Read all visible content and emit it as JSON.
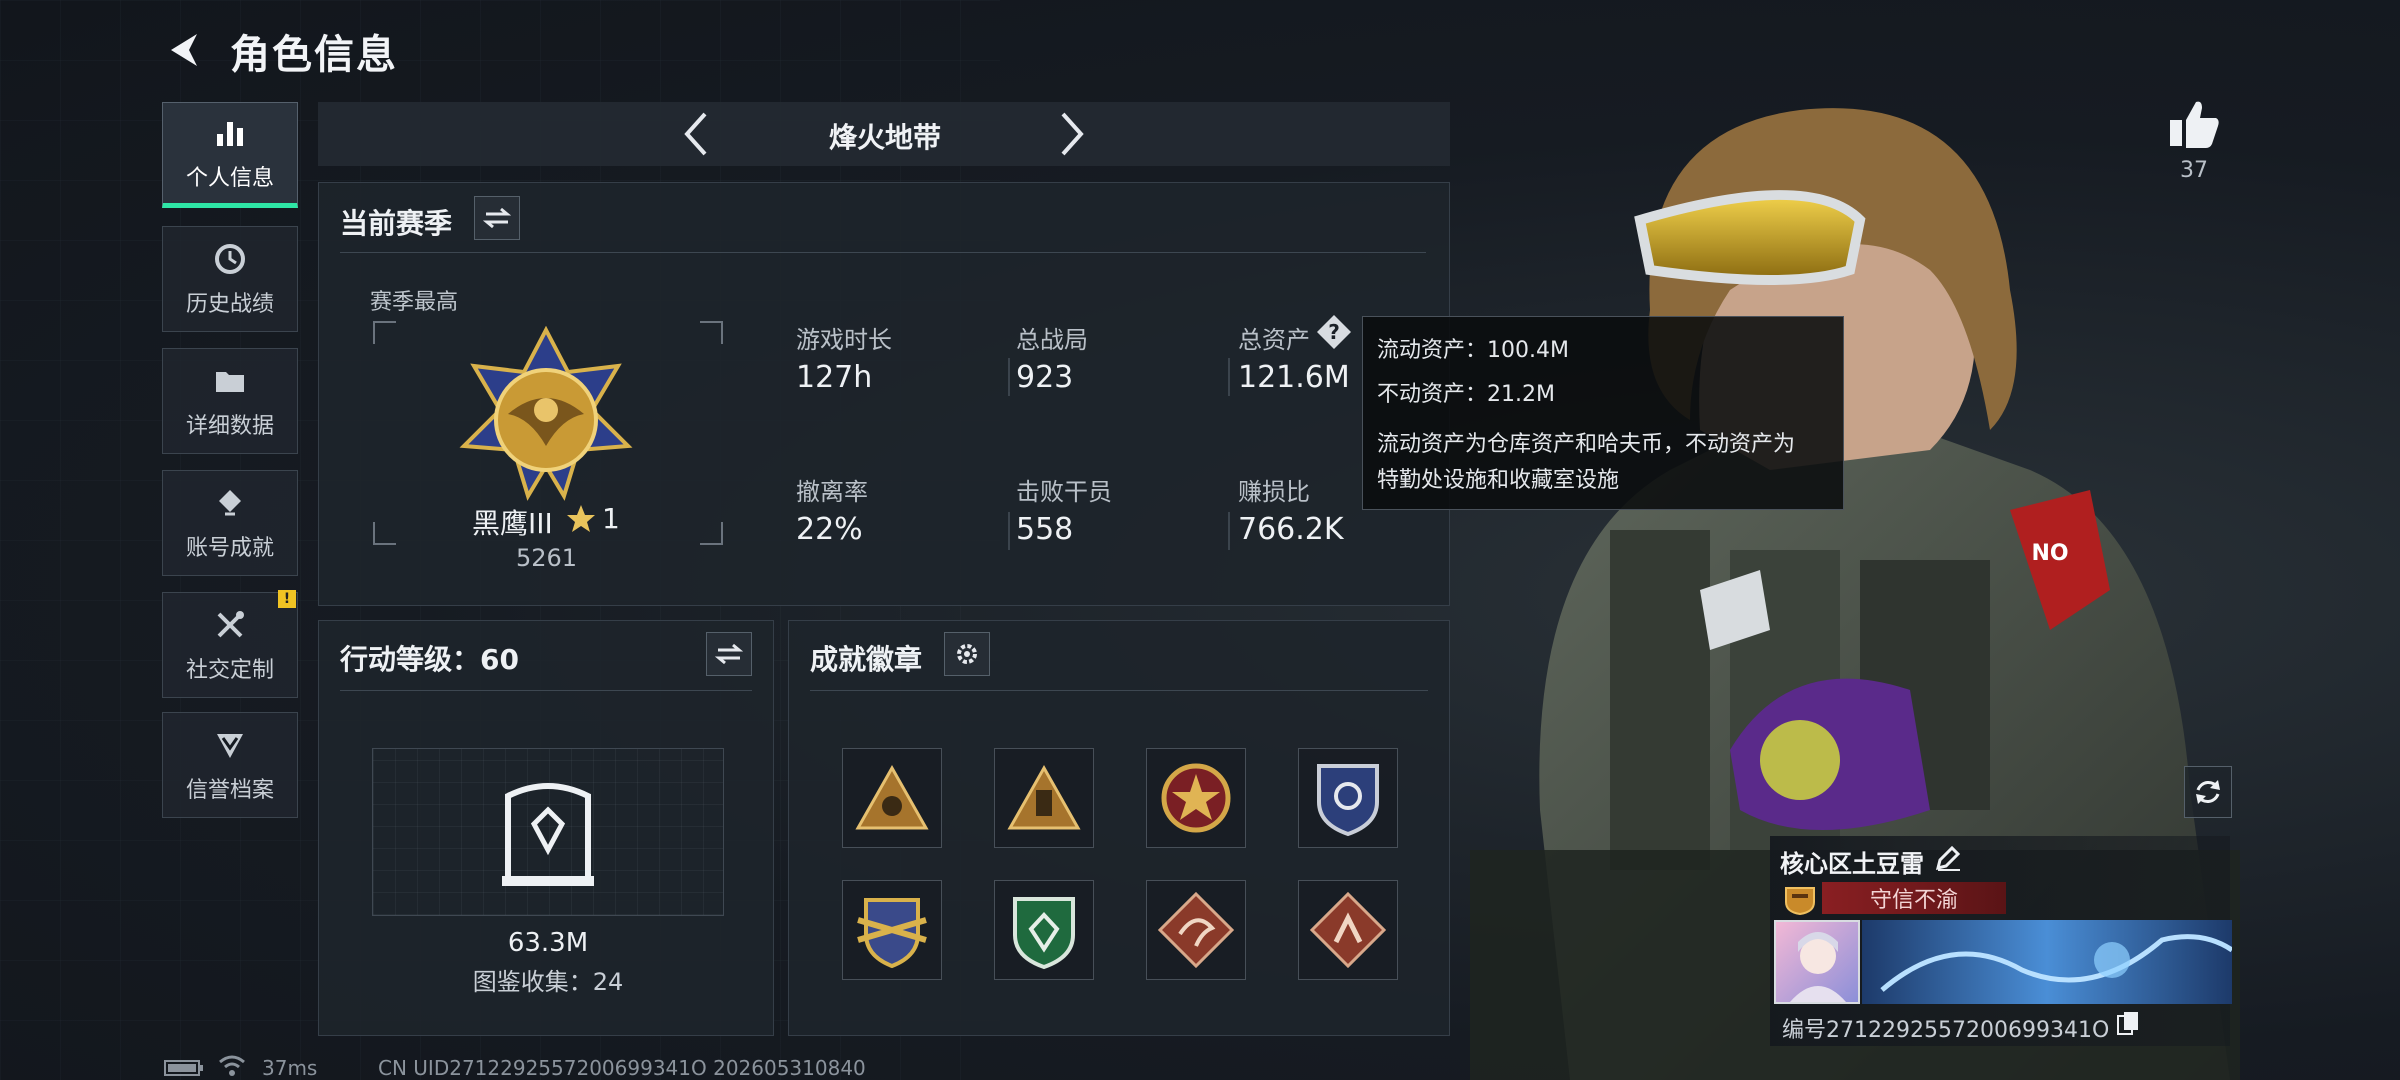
{
  "header": {
    "title": "角色信息"
  },
  "sidebar": {
    "items": [
      {
        "label": "个人信息",
        "icon": "bar-chart-icon",
        "active": true
      },
      {
        "label": "历史战绩",
        "icon": "clock-icon"
      },
      {
        "label": "详细数据",
        "icon": "folder-icon"
      },
      {
        "label": "账号成就",
        "icon": "achievement-icon"
      },
      {
        "label": "社交定制",
        "icon": "tools-icon",
        "notification": "!"
      },
      {
        "label": "信誉档案",
        "icon": "shield-icon"
      }
    ]
  },
  "mode": {
    "name": "烽火地带"
  },
  "season": {
    "title": "当前赛季",
    "best_label": "赛季最高",
    "rank_name": "黑鹰III",
    "rank_stars": "1",
    "rank_score": "5261",
    "stats": [
      {
        "label": "游戏时长",
        "value": "127h"
      },
      {
        "label": "总战局",
        "value": "923"
      },
      {
        "label": "总资产",
        "value": "121.6M"
      },
      {
        "label": "撤离率",
        "value": "22%"
      },
      {
        "label": "击败干员",
        "value": "558"
      },
      {
        "label": "赚损比",
        "value": "766.2K"
      }
    ]
  },
  "tooltip": {
    "line1": "流动资产：100.4M",
    "line2": "不动资产：21.2M",
    "desc_line1": "流动资产为仓库资产和哈夫币，不动资产为",
    "desc_line2": "特勤处设施和收藏室设施"
  },
  "action_level": {
    "title": "行动等级：60",
    "collection_value": "63.3M",
    "collection_label": "图鉴收集：24"
  },
  "achievements": {
    "title": "成就徽章",
    "badges": [
      "badge-1",
      "badge-2",
      "badge-3",
      "badge-4",
      "badge-5",
      "badge-6",
      "badge-7",
      "badge-8"
    ]
  },
  "likes": {
    "count": "37"
  },
  "profile": {
    "name": "核心区土豆雷",
    "title_badge": "守信不渝",
    "id_line": "编号2712292557200699341O"
  },
  "status_bar": {
    "ping": "37ms",
    "uid": "CN UID2712292557200699341O 202605310840"
  },
  "colors": {
    "accent": "#2ee6a6",
    "notice": "#f0c323",
    "title_badge_bg": "#8a1f22"
  }
}
